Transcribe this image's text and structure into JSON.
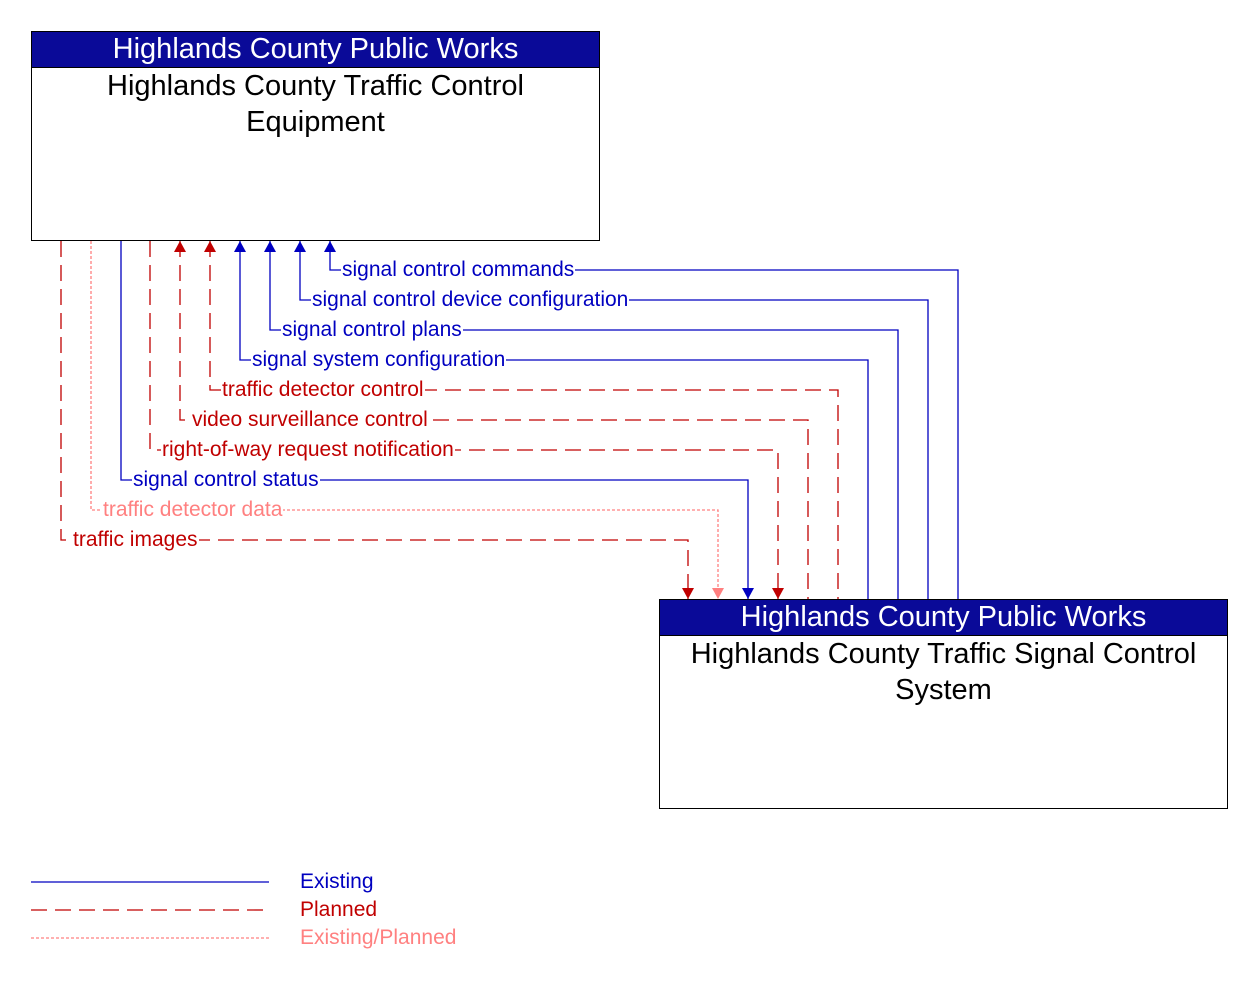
{
  "colors": {
    "existing": "#0000c0",
    "planned": "#c00000",
    "existing_planned": "#ff8080",
    "header_bg": "#0a0a98"
  },
  "elements": {
    "source": {
      "agency": "Highlands County Public Works",
      "name": "Highlands County Traffic Control Equipment"
    },
    "target": {
      "agency": "Highlands County Public Works",
      "name": "Highlands County Traffic Signal Control System"
    }
  },
  "flows": [
    {
      "label": "signal control commands",
      "status": "existing",
      "direction": "to-source"
    },
    {
      "label": "signal control device configuration",
      "status": "existing",
      "direction": "to-source"
    },
    {
      "label": "signal control plans",
      "status": "existing",
      "direction": "to-source"
    },
    {
      "label": "signal system configuration",
      "status": "existing",
      "direction": "to-source"
    },
    {
      "label": "traffic detector control",
      "status": "planned",
      "direction": "to-source"
    },
    {
      "label": "video surveillance control",
      "status": "planned",
      "direction": "to-source"
    },
    {
      "label": "right-of-way request notification",
      "status": "planned",
      "direction": "to-target"
    },
    {
      "label": "signal control status",
      "status": "existing",
      "direction": "to-target"
    },
    {
      "label": "traffic detector data",
      "status": "existing_planned",
      "direction": "to-target"
    },
    {
      "label": "traffic images",
      "status": "planned",
      "direction": "to-target"
    }
  ],
  "legend": [
    {
      "label": "Existing",
      "status": "existing"
    },
    {
      "label": "Planned",
      "status": "planned"
    },
    {
      "label": "Existing/Planned",
      "status": "existing_planned"
    }
  ]
}
